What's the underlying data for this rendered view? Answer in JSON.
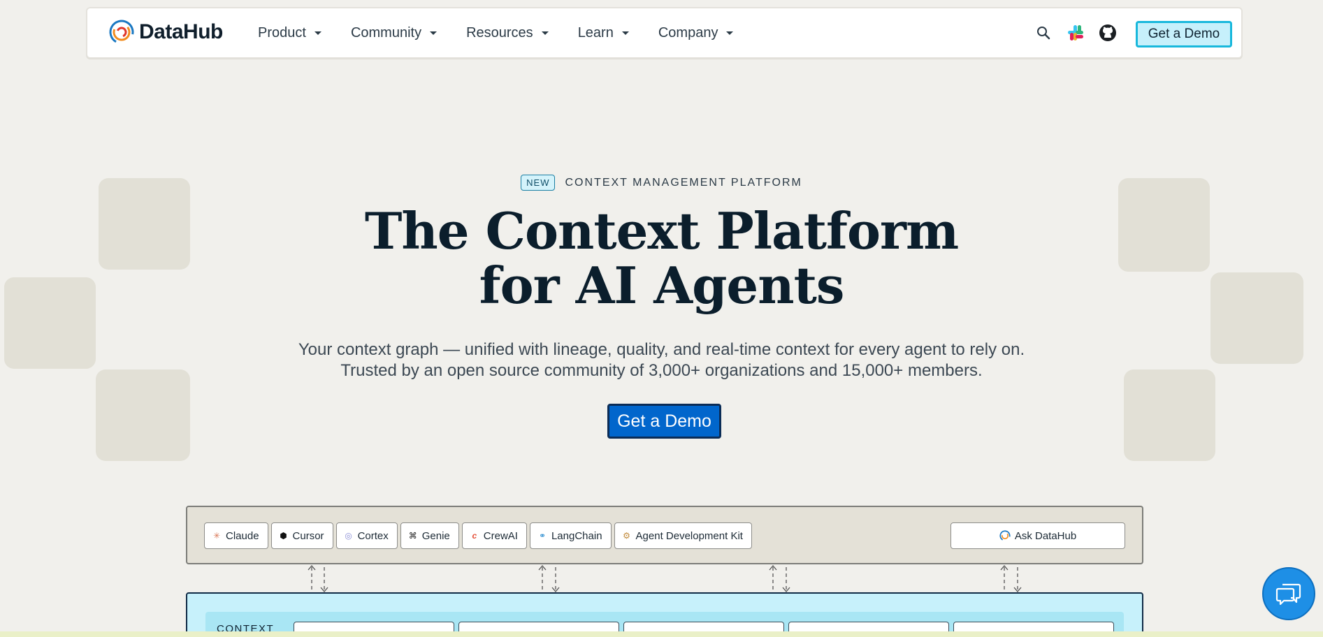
{
  "brand": {
    "name": "DataHub"
  },
  "nav": {
    "menu": [
      {
        "label": "Product"
      },
      {
        "label": "Community"
      },
      {
        "label": "Resources"
      },
      {
        "label": "Learn"
      },
      {
        "label": "Company"
      }
    ],
    "icons": [
      "search-icon",
      "slack-icon",
      "github-icon"
    ],
    "cta_label": "Get a Demo"
  },
  "hero": {
    "badge": "NEW",
    "eyebrow": "CONTEXT MANAGEMENT PLATFORM",
    "headline_line1": "The Context Platform",
    "headline_line2": "for AI Agents",
    "subtitle_line1": "Your context graph — unified with lineage, quality, and real-time context for every agent to rely on.",
    "subtitle_line2": "Trusted by an open source community of 3,000+ organizations and 15,000+ members.",
    "cta_label": "Get a Demo"
  },
  "diagram": {
    "agents": [
      {
        "label": "Claude",
        "icon": "claude-icon"
      },
      {
        "label": "Cursor",
        "icon": "cursor-icon"
      },
      {
        "label": "Cortex",
        "icon": "cortex-icon"
      },
      {
        "label": "Genie",
        "icon": "genie-icon"
      },
      {
        "label": "CrewAI",
        "icon": "crewai-icon"
      },
      {
        "label": "LangChain",
        "icon": "langchain-icon"
      },
      {
        "label": "Agent Development Kit",
        "icon": "adk-icon"
      }
    ],
    "ask_label": "Ask DataHub",
    "context_label": "CONTEXT"
  },
  "colors": {
    "background": "#f1f0ec",
    "primary_cta": "#0166cc",
    "nav_cta_bg": "#c6f0fb",
    "nav_cta_border": "#18b8dc",
    "context_bg": "#c7f1fb",
    "chat_bubble": "#1e8fe6"
  }
}
